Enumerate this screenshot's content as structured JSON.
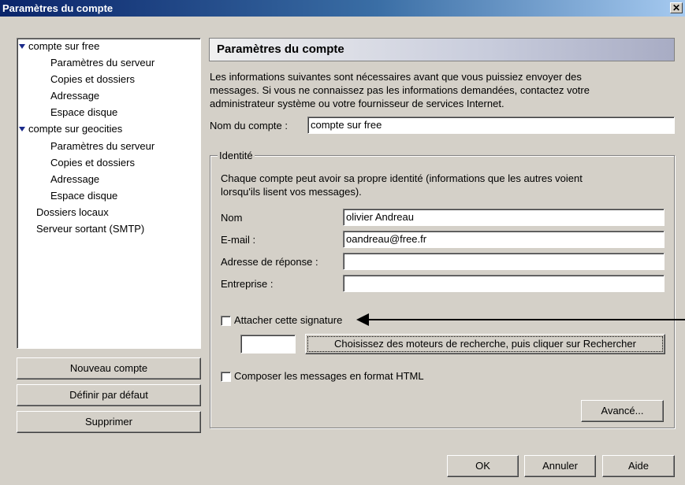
{
  "window": {
    "title": "Paramètres du compte",
    "close_glyph": "✕"
  },
  "tree": {
    "items": [
      {
        "label": "compte sur free",
        "expanded": true
      },
      {
        "label": "Paramètres du serveur"
      },
      {
        "label": "Copies et dossiers"
      },
      {
        "label": "Adressage"
      },
      {
        "label": "Espace disque"
      },
      {
        "label": "compte sur geocities",
        "expanded": true
      },
      {
        "label": "Paramètres du serveur"
      },
      {
        "label": "Copies et dossiers"
      },
      {
        "label": "Adressage"
      },
      {
        "label": "Espace disque"
      },
      {
        "label": "Dossiers locaux"
      },
      {
        "label": "Serveur sortant (SMTP)"
      }
    ]
  },
  "left_buttons": {
    "new_account": "Nouveau compte",
    "set_default": "Définir par défaut",
    "delete": "Supprimer"
  },
  "panel": {
    "title": "Paramètres du compte",
    "intro_line1": "Les informations suivantes sont nécessaires avant que vous puissiez envoyer des",
    "intro_line2": "messages. Si vous ne connaissez pas les informations demandées, contactez votre",
    "intro_line3": "administrateur système ou votre fournisseur de services Internet.",
    "account_name_label": "Nom du compte :",
    "account_name_value": "compte sur free"
  },
  "identity": {
    "legend": "Identité",
    "desc_line1": "Chaque compte peut avoir sa propre identité (informations que les autres voient",
    "desc_line2": "lorsqu'ils lisent vos messages).",
    "name_label": "Nom",
    "name_value": "olivier Andreau",
    "email_label": "E-mail :",
    "email_value": "oandreau@free.fr",
    "reply_label": "Adresse de réponse :",
    "reply_value": "",
    "org_label": "Entreprise :",
    "org_value": "",
    "signature_label": "Attacher cette signature",
    "signature_checked": false,
    "search_button": "Choisissez des moteurs de recherche, puis cliquer sur Rechercher",
    "html_label": "Composer les messages en format HTML",
    "html_checked": false,
    "advanced_button": "Avancé..."
  },
  "dialog_buttons": {
    "ok": "OK",
    "cancel": "Annuler",
    "help": "Aide"
  },
  "colors": {
    "titlebar_start": "#0a246a",
    "titlebar_end": "#a6caf0",
    "face": "#d4d0c8",
    "tree_arrow": "#1a2a8a"
  }
}
